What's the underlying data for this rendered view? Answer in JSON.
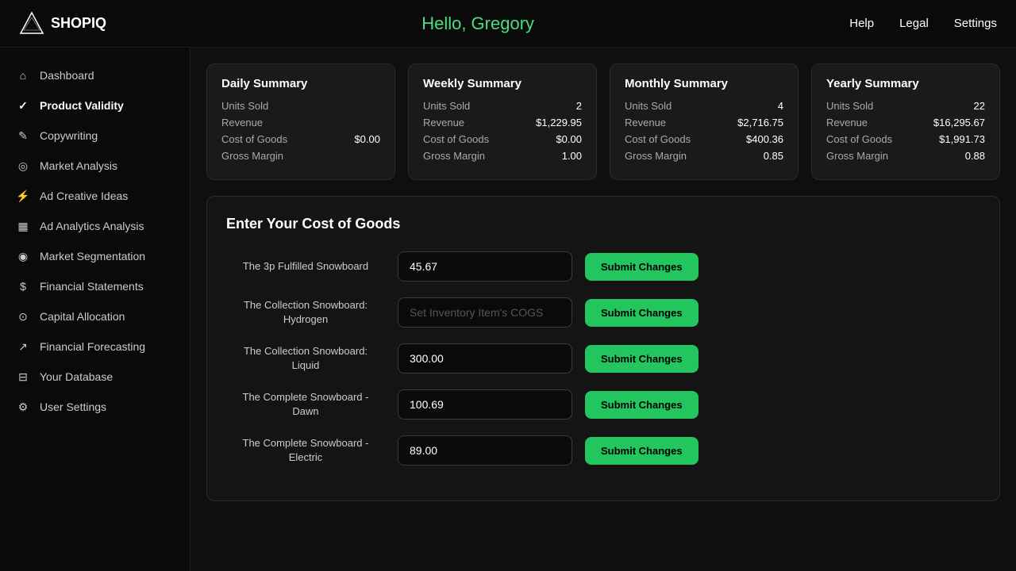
{
  "app": {
    "logo_text": "SHOPIQ",
    "greeting": "Hello, Gregory"
  },
  "top_nav": {
    "links": [
      {
        "id": "help",
        "label": "Help"
      },
      {
        "id": "legal",
        "label": "Legal"
      },
      {
        "id": "settings",
        "label": "Settings"
      }
    ]
  },
  "sidebar": {
    "items": [
      {
        "id": "dashboard",
        "label": "Dashboard",
        "icon": "⌂"
      },
      {
        "id": "product-validity",
        "label": "Product Validity",
        "icon": "✓"
      },
      {
        "id": "copywriting",
        "label": "Copywriting",
        "icon": "✎"
      },
      {
        "id": "market-analysis",
        "label": "Market Analysis",
        "icon": "◎"
      },
      {
        "id": "ad-creative-ideas",
        "label": "Ad Creative Ideas",
        "icon": "⚡"
      },
      {
        "id": "ad-analytics",
        "label": "Ad Analytics Analysis",
        "icon": "▦"
      },
      {
        "id": "market-segmentation",
        "label": "Market Segmentation",
        "icon": "◉"
      },
      {
        "id": "financial-statements",
        "label": "Financial Statements",
        "icon": "$"
      },
      {
        "id": "capital-allocation",
        "label": "Capital Allocation",
        "icon": "⊙"
      },
      {
        "id": "financial-forecasting",
        "label": "Financial Forecasting",
        "icon": "↗"
      },
      {
        "id": "your-database",
        "label": "Your Database",
        "icon": "⊟"
      },
      {
        "id": "user-settings",
        "label": "User Settings",
        "icon": "⚙"
      }
    ]
  },
  "summary_cards": [
    {
      "title": "Daily Summary",
      "rows": [
        {
          "label": "Units Sold",
          "value": ""
        },
        {
          "label": "Revenue",
          "value": ""
        },
        {
          "label": "Cost of Goods",
          "value": "$0.00"
        },
        {
          "label": "Gross Margin",
          "value": ""
        }
      ]
    },
    {
      "title": "Weekly Summary",
      "rows": [
        {
          "label": "Units Sold",
          "value": "2"
        },
        {
          "label": "Revenue",
          "value": "$1,229.95"
        },
        {
          "label": "Cost of Goods",
          "value": "$0.00"
        },
        {
          "label": "Gross Margin",
          "value": "1.00"
        }
      ]
    },
    {
      "title": "Monthly Summary",
      "rows": [
        {
          "label": "Units Sold",
          "value": "4"
        },
        {
          "label": "Revenue",
          "value": "$2,716.75"
        },
        {
          "label": "Cost of Goods",
          "value": "$400.36"
        },
        {
          "label": "Gross Margin",
          "value": "0.85"
        }
      ]
    },
    {
      "title": "Yearly Summary",
      "rows": [
        {
          "label": "Units Sold",
          "value": "22"
        },
        {
          "label": "Revenue",
          "value": "$16,295.67"
        },
        {
          "label": "Cost of Goods",
          "value": "$1,991.73"
        },
        {
          "label": "Gross Margin",
          "value": "0.88"
        }
      ]
    }
  ],
  "cog_section": {
    "title": "Enter Your Cost of Goods",
    "submit_label": "Submit Changes",
    "products": [
      {
        "id": "3p-fulfilled",
        "name": "The 3p Fulfilled Snowboard",
        "value": "45.67",
        "placeholder": ""
      },
      {
        "id": "collection-hydrogen",
        "name": "The Collection Snowboard:\nHydrogen",
        "value": "",
        "placeholder": "Set Inventory Item's COGS"
      },
      {
        "id": "collection-liquid",
        "name": "The Collection Snowboard:\nLiquid",
        "value": "300.00",
        "placeholder": ""
      },
      {
        "id": "complete-dawn",
        "name": "The Complete Snowboard -\nDawn",
        "value": "100.69",
        "placeholder": ""
      },
      {
        "id": "complete-electric",
        "name": "The Complete Snowboard -\nElectric",
        "value": "89.00",
        "placeholder": ""
      }
    ]
  }
}
